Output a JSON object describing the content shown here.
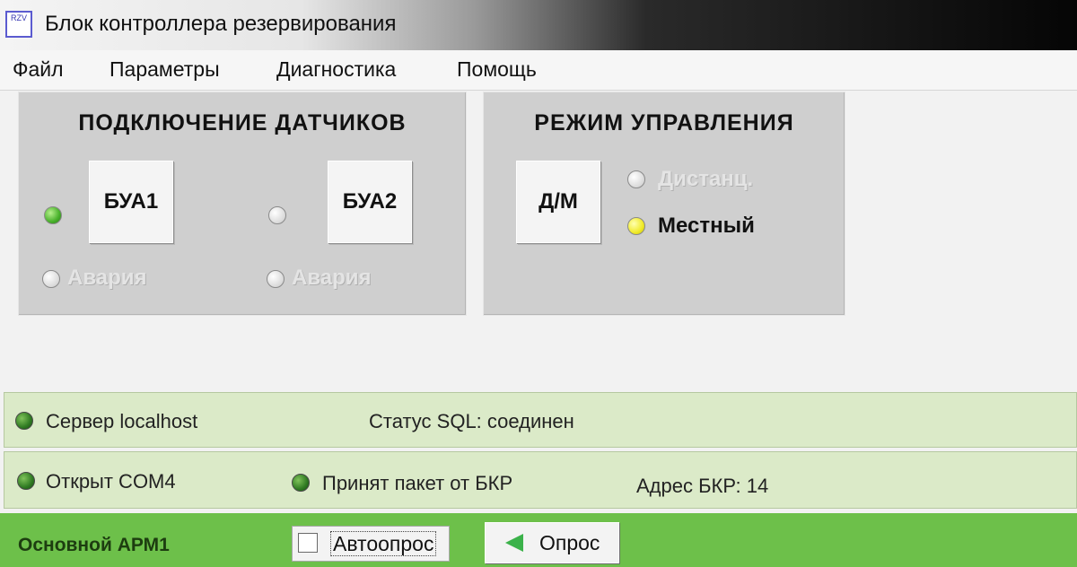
{
  "window": {
    "title": "Блок контроллера резервирования",
    "icon_text": "RZV"
  },
  "menu": [
    "Файл",
    "Параметры",
    "Диагностика",
    "Помощь"
  ],
  "sensors_panel": {
    "title": "ПОДКЛЮЧЕНИЕ ДАТЧИКОВ",
    "bua1": {
      "label": "БУА1",
      "led": "green",
      "alarm_label": "Авария"
    },
    "bua2": {
      "label": "БУА2",
      "led": "grey",
      "alarm_label": "Авария"
    }
  },
  "mode_panel": {
    "title": "РЕЖИМ УПРАВЛЕНИЯ",
    "button_label": "Д/М",
    "remote_label": "Дистанц.",
    "local_label": "Местный"
  },
  "status": {
    "server": "Сервер localhost",
    "sql_status": "Статус SQL: соединен",
    "com_port": "Открыт COM4",
    "packet": "Принят пакет от БКР",
    "address": "Адрес БКР: 14"
  },
  "bottom": {
    "arm_label": "Основной АРМ1",
    "autopoll_label": "Автоопрос",
    "autopoll_checked": false,
    "poll_label": "Опрос"
  },
  "colors": {
    "green_bar": "#6dc04a",
    "status_bg": "#dbeac8",
    "panel_bg": "#cfcfcf"
  }
}
